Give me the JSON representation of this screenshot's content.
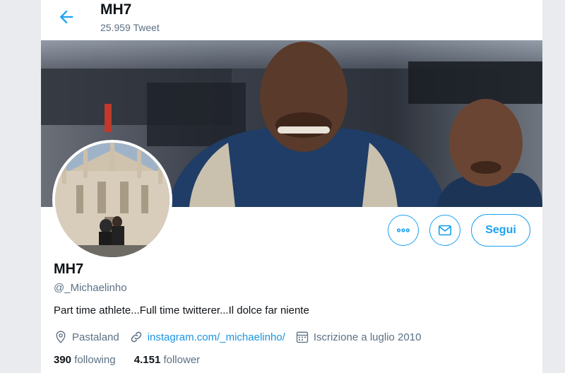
{
  "header": {
    "title": "MH7",
    "tweet_count": "25.959 Tweet"
  },
  "profile": {
    "name": "MH7",
    "handle": "@_Michaelinho",
    "bio": "Part time athlete...Full time twitterer...Il dolce far niente",
    "location": "Pastaland",
    "website": "instagram.com/_michaelinho/",
    "joined": "Iscrizione a luglio 2010"
  },
  "stats": {
    "following_count": "390",
    "following_label": "following",
    "follower_count": "4.151",
    "follower_label": "follower"
  },
  "actions": {
    "follow_label": "Segui"
  },
  "icons": {
    "back": "arrow-left-icon",
    "more": "more-horizontal-icon",
    "message": "mail-icon",
    "location": "location-pin-icon",
    "link": "link-icon",
    "calendar": "calendar-icon"
  },
  "colors": {
    "accent": "#1da1f2",
    "link": "#1b95e0",
    "text_primary": "#0f1419",
    "text_secondary": "#5b7083"
  }
}
